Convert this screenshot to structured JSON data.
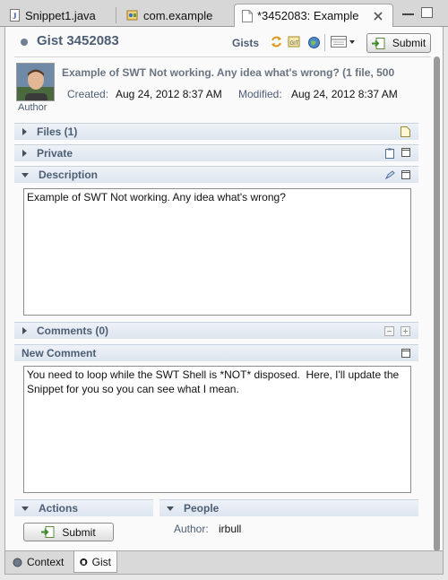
{
  "editor_tabs": [
    {
      "label": "Snippet1.java"
    },
    {
      "label": "com.example"
    },
    {
      "label": "*3452083: Example"
    }
  ],
  "header": {
    "title": "Gist 3452083",
    "gists_label": "Gists",
    "submit_label": "Submit"
  },
  "summary": {
    "description": "Example of SWT Not working. Any idea what's wrong? (1 file, 500",
    "created_label": "Created:",
    "created_value": "Aug 24, 2012 8:37 AM",
    "modified_label": "Modified:",
    "modified_value": "Aug 24, 2012 8:37 AM",
    "author_caption": "Author"
  },
  "sections": {
    "files": "Files (1)",
    "private": "Private",
    "description": "Description",
    "comments": "Comments (0)",
    "new_comment": "New Comment",
    "actions": "Actions",
    "people": "People"
  },
  "description_text": "Example of SWT Not working. Any idea what's wrong?",
  "new_comment_text": "You need to loop while the SWT Shell is *NOT* disposed.  Here, I'll update the Snippet for you so you can see what I mean.",
  "actions": {
    "submit_label": "Submit"
  },
  "people": {
    "author_label": "Author:",
    "author_value": "irbull"
  },
  "bottom_tabs": [
    {
      "label": "Context"
    },
    {
      "label": "Gist"
    }
  ],
  "colors": {
    "section_text": "#4d5e74",
    "section_bar": "#e3e9f2",
    "background": "#fafafa"
  }
}
